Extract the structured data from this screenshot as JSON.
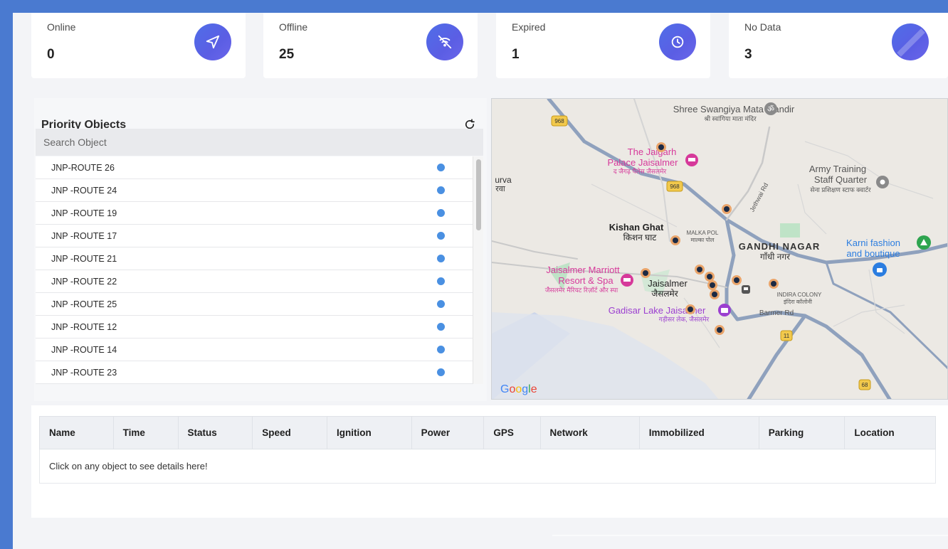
{
  "stats": [
    {
      "label": "Online",
      "value": "0",
      "icon": "send-icon"
    },
    {
      "label": "Offline",
      "value": "25",
      "icon": "wifi-off-icon"
    },
    {
      "label": "Expired",
      "value": "1",
      "icon": "clock-icon"
    },
    {
      "label": "No Data",
      "value": "3",
      "icon": "no-data-icon"
    }
  ],
  "priority": {
    "title": "Priority Objects",
    "search_placeholder": "Search Object",
    "items": [
      {
        "name": "JNP-ROUTE 26"
      },
      {
        "name": "JNP -ROUTE 24"
      },
      {
        "name": "JNP -ROUTE 19"
      },
      {
        "name": "JNP -ROUTE 17"
      },
      {
        "name": "JNP -ROUTE 21"
      },
      {
        "name": "JNP -ROUTE 22"
      },
      {
        "name": "JNP -ROUTE 25"
      },
      {
        "name": "JNP -ROUTE 12"
      },
      {
        "name": "JNP -ROUTE 14"
      },
      {
        "name": "JNP -ROUTE 23"
      }
    ]
  },
  "map": {
    "labels": {
      "mata_mandir": "Shree Swangiya Mata Mandir",
      "mata_mandir_hi": "श्री स्वांगिया माता मंदिर",
      "palace_1": "The Jaigarh",
      "palace_2": "Palace Jaisalmer",
      "palace_hi": "द जैगढ़ पैलेस जैसलमेर",
      "army_1": "Army Training",
      "army_2": "Staff Quarter",
      "army_hi": "सेना प्रशिक्षण स्टाफ क्वार्टर",
      "purva": "urva",
      "purva_hi": "रवा",
      "kishan": "Kishan Ghat",
      "kishan_hi": "किशन घाट",
      "malka": "MALKA POL",
      "malka_hi": "माल्का पोल",
      "gandhi": "GANDHI NAGAR",
      "gandhi_hi": "गाँधी नगर",
      "karni_1": "Karni fashion",
      "karni_2": "and boutique",
      "marriott_1": "Jaisalmer Marriott",
      "marriott_2": "Resort & Spa",
      "marriott_hi": "जैसलमेर मैरियट रिज़ॉर्ट और स्पा",
      "jaisalmer": "Jaisalmer",
      "jaisalmer_hi": "जैसलमेर",
      "indira": "INDIRA COLONY",
      "indira_hi": "इंदिरा कॉलोनी",
      "gadisar": "Gadisar Lake Jaisalmer",
      "gadisar_hi": "गड़ीसर लेक, जैसलमेर",
      "barmer": "Barmer Rd",
      "jethwai": "Jethwai Rd",
      "road_968": "968",
      "road_11": "11",
      "road_68": "68",
      "google": "Google"
    },
    "colors": {
      "road": "#8fa1bd",
      "poi_pink": "#d6399a",
      "poi_purple": "#9b3fd0",
      "poi_blue": "#2b7de0"
    }
  },
  "table": {
    "columns": [
      "Name",
      "Time",
      "Status",
      "Speed",
      "Ignition",
      "Power",
      "GPS",
      "Network",
      "Immobilized",
      "Parking",
      "Location"
    ],
    "empty_message": "Click on any object to see details here!"
  }
}
